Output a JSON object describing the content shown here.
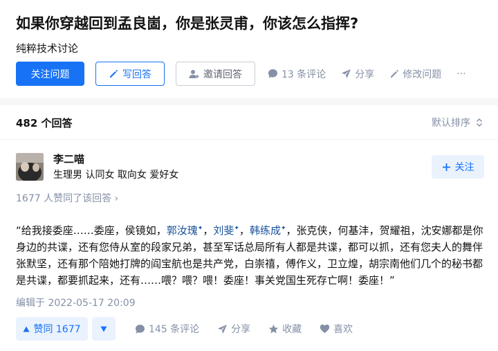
{
  "question": {
    "title": "如果你穿越回到孟良崮，你是张灵甫，你该怎么指挥?",
    "detail": "纯粹技术讨论",
    "follow_label": "关注问题",
    "write_label": "写回答",
    "invite_label": "邀请回答",
    "comments_label": "13 条评论",
    "share_label": "分享",
    "edit_label": "修改问题",
    "more_label": "···"
  },
  "answers_header": {
    "count_label": "482 个回答",
    "sort_label": "默认排序"
  },
  "answer": {
    "author": {
      "name": "李二喵",
      "bio": "生理男 认同女 取向女 爱好女",
      "follow_label": "关注"
    },
    "votes_line": "1677 人赞同了该回答 ›",
    "content": {
      "p1": "“给我接委座……委座，侯镜如，",
      "link1": "郭汝瑰",
      "p2": "，",
      "link2": "刘斐",
      "p3": "，",
      "link3": "韩练成",
      "p4": "，张克侠，何基沣，贺耀祖，沈安娜都是你身边的共谍，还有您侍从室的段家兄弟，甚至军话总局所有人都是共谍，都可以抓，还有您夫人的舞伴张默坚，还有那个陪她打牌的阎宝航也是共产党，白崇禧，傅作义，卫立煌，胡宗南他们几个的秘书都是共谍，都要抓起来，还有……喂？喂？喂！委座！事关党国生死存亡啊！委座！”",
      "star": "✦"
    },
    "edit_time": "编辑于 2022-05-17 20:09",
    "actions": {
      "upvote_label": "赞同 1677",
      "comments_label": "145 条评论",
      "share_label": "分享",
      "favorite_label": "收藏",
      "like_label": "喜欢"
    }
  },
  "colors": {
    "brand": "#1772f6",
    "muted": "#8590a6",
    "link": "#175199"
  }
}
